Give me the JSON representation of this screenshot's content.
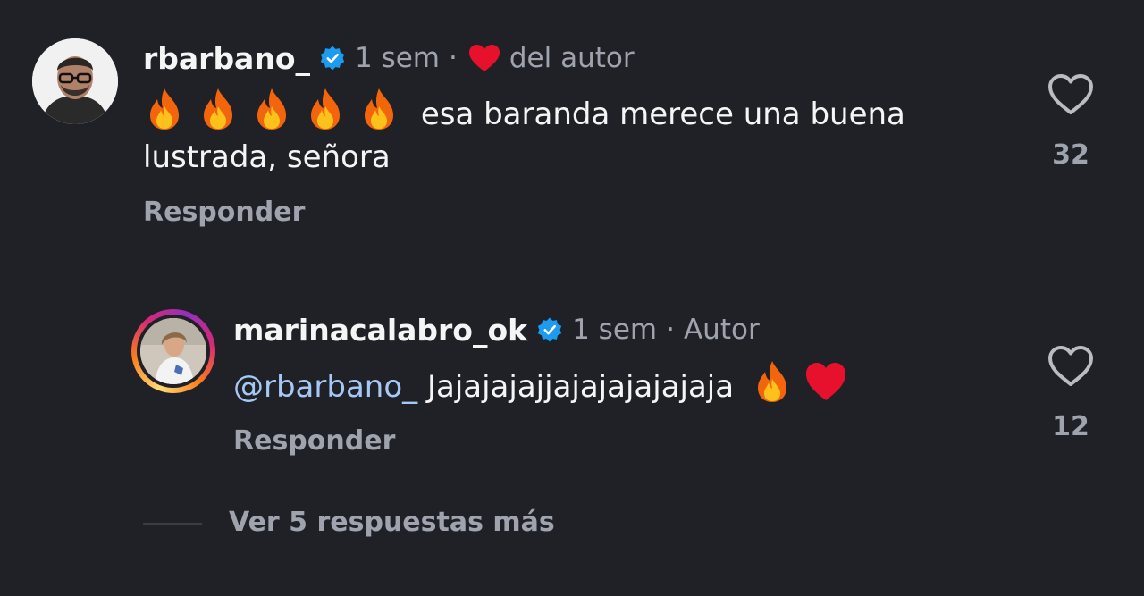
{
  "comments": [
    {
      "username": "rbarbano_",
      "time": "1 sem",
      "separator": "·",
      "author_liked_label": "del autor",
      "text": "esa baranda merece una buena lustrada, señora",
      "fire_emoji_count": 5,
      "reply_label": "Responder",
      "like_count": "32",
      "verified": true
    },
    {
      "username": "marinacalabro_ok",
      "time": "1 sem",
      "separator": "·",
      "author_badge": "Autor",
      "mention": "@rbarbano_",
      "text": "Jajajajajjajajajajajaja",
      "reply_label": "Responder",
      "like_count": "12",
      "verified": true
    }
  ],
  "view_more_label": "Ver 5 respuestas más",
  "colors": {
    "background": "#1f2127",
    "verified_blue": "#1d9bf0",
    "heart_red": "#e8112d",
    "muted_text": "#9ea3ad",
    "mention": "#a5c8f5"
  },
  "icons": [
    "verified-badge-icon",
    "heart-icon",
    "fire-emoji",
    "red-heart-emoji",
    "heart-outline-icon"
  ]
}
